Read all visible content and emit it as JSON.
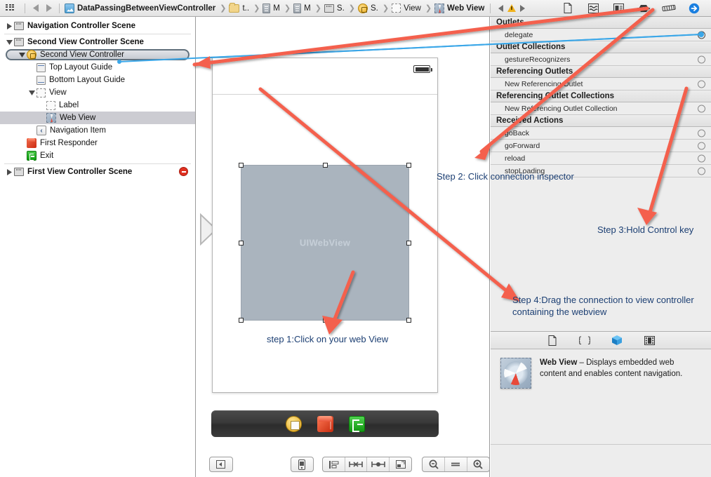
{
  "topbar": {
    "grid_icon": "grid-icon",
    "back_icon": "back-arrow-icon",
    "forward_icon": "forward-arrow-icon",
    "breadcrumbs": [
      {
        "label": "DataPassingBetweenViewController",
        "icon": "xcode-project-icon",
        "bold": true
      },
      {
        "label": "t..",
        "icon": "folder-icon",
        "bold": false
      },
      {
        "label": "M",
        "icon": "objc-file-icon",
        "bold": false
      },
      {
        "label": "M",
        "icon": "objc-file-icon",
        "bold": false
      },
      {
        "label": "S.",
        "icon": "storyboard-icon",
        "bold": false
      },
      {
        "label": "S.",
        "icon": "view-controller-icon",
        "bold": false
      },
      {
        "label": "View",
        "icon": "view-icon",
        "bold": false
      },
      {
        "label": "Web View",
        "icon": "web-view-icon",
        "bold": true
      }
    ],
    "issue_prev_icon": "issue-previous-icon",
    "issue_warning_icon": "warning-triangle-icon",
    "issue_next_icon": "issue-next-icon",
    "inspector_tabs": [
      {
        "name": "file-inspector-icon"
      },
      {
        "name": "quick-help-inspector-icon"
      },
      {
        "name": "identity-inspector-icon"
      },
      {
        "name": "attributes-inspector-icon"
      },
      {
        "name": "size-inspector-icon"
      },
      {
        "name": "connections-inspector-icon",
        "selected": true
      }
    ]
  },
  "outline": {
    "rows": [
      {
        "label": "Navigation Controller Scene",
        "icon": "scene-icon",
        "indent": 0,
        "twisty": "collapsed",
        "scene": true
      },
      {
        "label": "Second View Controller Scene",
        "icon": "scene-icon",
        "indent": 0,
        "twisty": "expanded",
        "scene": true
      },
      {
        "label": "Second View Controller",
        "icon": "view-controller-icon",
        "indent": 1,
        "twisty": "expanded",
        "highlight": true
      },
      {
        "label": "Top Layout Guide",
        "icon": "top-layout-guide-icon",
        "indent": 3,
        "twisty": "none"
      },
      {
        "label": "Bottom Layout Guide",
        "icon": "bottom-layout-guide-icon",
        "indent": 3,
        "twisty": "none"
      },
      {
        "label": "View",
        "icon": "view-icon",
        "indent": 2,
        "twisty": "expanded"
      },
      {
        "label": "Label",
        "icon": "label-icon",
        "indent": 4,
        "twisty": "none"
      },
      {
        "label": "Web View",
        "icon": "web-view-icon",
        "indent": 4,
        "twisty": "none",
        "selected": true
      },
      {
        "label": "Navigation Item",
        "icon": "navigation-item-icon",
        "indent": 2,
        "twisty": "none"
      },
      {
        "label": "First Responder",
        "icon": "first-responder-icon",
        "indent": 1,
        "twisty": "none"
      },
      {
        "label": "Exit",
        "icon": "exit-icon",
        "indent": 1,
        "twisty": "none"
      },
      {
        "label": "First View Controller Scene",
        "icon": "scene-icon",
        "indent": 0,
        "twisty": "collapsed",
        "scene": true,
        "error_badge": true
      }
    ]
  },
  "canvas": {
    "web_view_placeholder": "UIWebView",
    "dock_items": [
      {
        "name": "dock-view-controller-icon"
      },
      {
        "name": "dock-first-responder-icon"
      },
      {
        "name": "dock-exit-icon"
      }
    ],
    "toolbar": {
      "groups": [
        {
          "buttons": [
            {
              "name": "document-outline-toggle-button"
            }
          ]
        },
        {
          "buttons": [
            {
              "name": "device-preview-button"
            }
          ]
        },
        {
          "buttons": [
            {
              "name": "align-button"
            },
            {
              "name": "pin-button"
            },
            {
              "name": "resolve-auto-layout-issues-button"
            },
            {
              "name": "resizing-behavior-button"
            }
          ]
        },
        {
          "buttons": [
            {
              "name": "zoom-out-button"
            },
            {
              "name": "zoom-actual-size-button"
            },
            {
              "name": "zoom-in-button"
            }
          ]
        }
      ]
    }
  },
  "inspector": {
    "sections": [
      {
        "title": "Outlets",
        "rows": [
          {
            "label": "delegate",
            "connected": true
          }
        ]
      },
      {
        "title": "Outlet Collections",
        "rows": [
          {
            "label": "gestureRecognizers",
            "connected": false
          }
        ]
      },
      {
        "title": "Referencing Outlets",
        "rows": [
          {
            "label": "New Referencing Outlet",
            "connected": false
          }
        ]
      },
      {
        "title": "Referencing Outlet Collections",
        "rows": [
          {
            "label": "New Referencing Outlet Collection",
            "connected": false
          }
        ]
      },
      {
        "title": "Received Actions",
        "rows": [
          {
            "label": "goBack",
            "connected": false
          },
          {
            "label": "goForward",
            "connected": false
          },
          {
            "label": "reload",
            "connected": false
          },
          {
            "label": "stopLoading",
            "connected": false
          }
        ]
      }
    ],
    "library_tabs": [
      {
        "name": "file-template-library-icon"
      },
      {
        "name": "code-snippet-library-icon"
      },
      {
        "name": "object-library-icon",
        "selected": true
      },
      {
        "name": "media-library-icon"
      }
    ],
    "help": {
      "thumb_icon": "web-view-thumbnail-icon",
      "title": "Web View",
      "dash": " – ",
      "description": "Displays embedded web content and enables content navigation."
    }
  },
  "annotations": {
    "step1": "step 1:Click on your web View",
    "step2": "Step 2: Click connection inspector",
    "step3": "Step 3:Hold Control key",
    "step4_line1": "Step 4:Drag the connection to view controller",
    "step4_line2": "containing the webview",
    "arrow_color": "#f4604e",
    "connection_line_color": "#3ba7e8",
    "text_color": "#1c3f73"
  }
}
